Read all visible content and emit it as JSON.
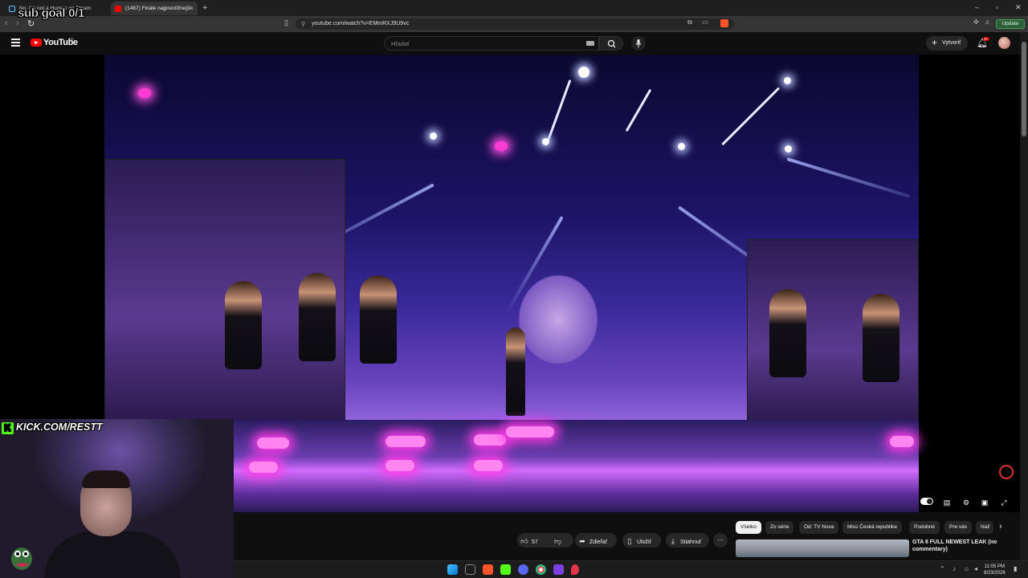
{
  "browser": {
    "tabs": [
      {
        "title": "No, I'm not a Human on Steam",
        "active": false
      },
      {
        "title": "(1487) Finále najprestížnejší",
        "active": true
      }
    ],
    "url": "youtube.com/watch?v=EMmRXJ9U9vc",
    "update_label": "Update"
  },
  "youtube": {
    "logo_text": "YouTube",
    "logo_sup": "SK",
    "search_placeholder": "Hľadať",
    "create_label": "Vytvoriť",
    "notifications_badge": "9+"
  },
  "actions": {
    "likes": "57",
    "share": "Zdieľať",
    "save": "Uložiť",
    "download": "Stiahnuť"
  },
  "chips": [
    "Všetko",
    "Zo série",
    "Od: TV Nova",
    "Miss Česká republika",
    "Podobné",
    "Pre vás",
    "Naž"
  ],
  "recommendation": {
    "title": "GTA 6 FULL NEWEST LEAK (no commentary)"
  },
  "overlay": {
    "sub_goal": "sub goal 0/1",
    "kick_url": "KICK.COM/RESTT"
  },
  "taskbar": {
    "time": "11:05 PM",
    "date": "8/23/2026"
  },
  "colors": {
    "youtube_red": "#ff0000",
    "kick_green": "#53fc18",
    "stage_purple": "#6a44c0",
    "update_green": "#3fa34d"
  }
}
